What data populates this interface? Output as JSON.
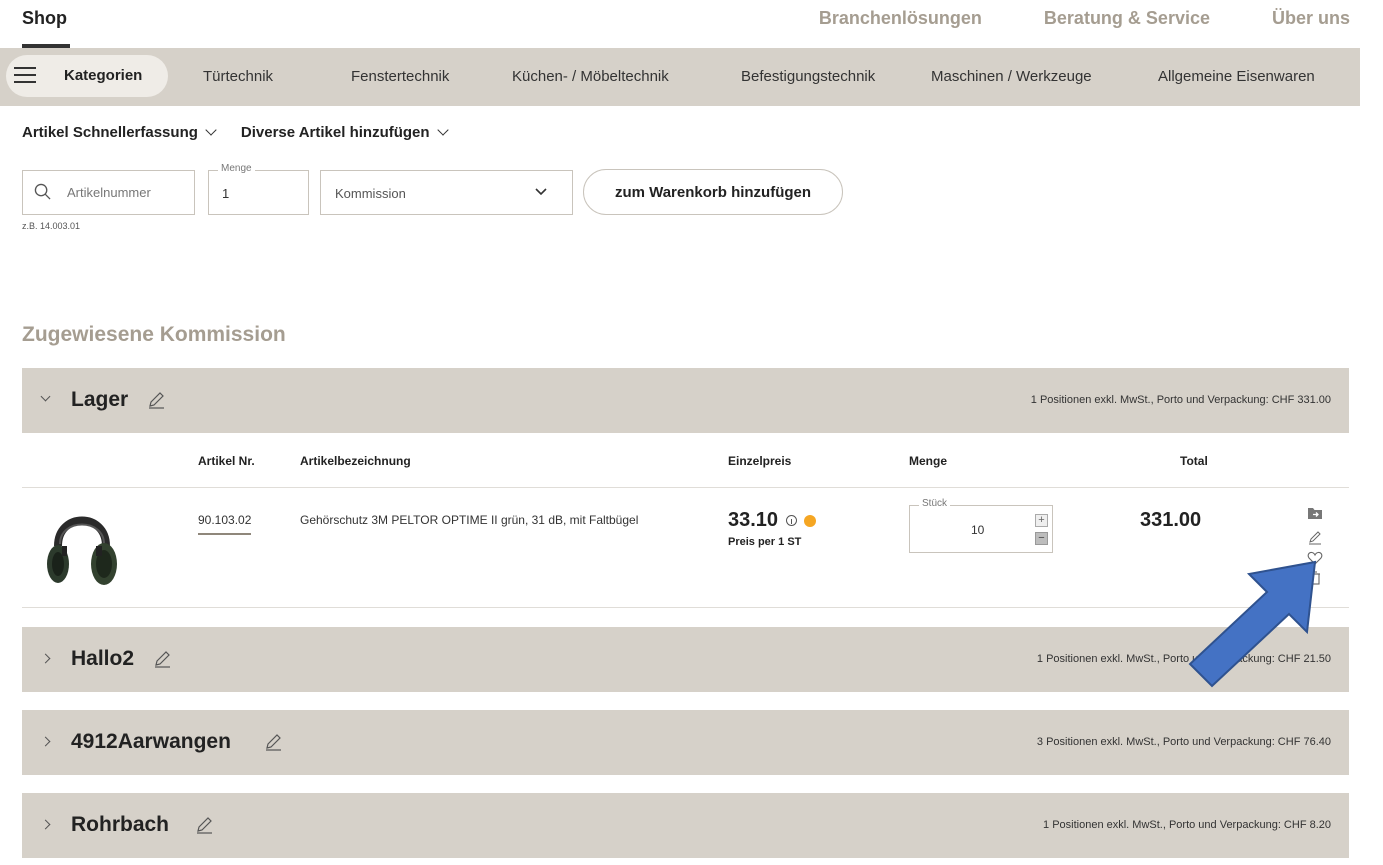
{
  "header": {
    "brand": "Shop",
    "nav": [
      "Branchenlösungen",
      "Beratung & Service",
      "Über uns"
    ]
  },
  "categories": {
    "menu_label": "Kategorien",
    "items": [
      "Türtechnik",
      "Fenstertechnik",
      "Küchen- / Möbeltechnik",
      "Befestigungstechnik",
      "Maschinen / Werkzeuge",
      "Allgemeine Eisenwaren"
    ]
  },
  "quick_entry": {
    "link_schnellerfassung": "Artikel Schnellerfassung",
    "link_diverse": "Diverse Artikel hinzufügen",
    "search_placeholder": "Artikelnummer",
    "search_hint": "z.B. 14.003.01",
    "menge_label": "Menge",
    "menge_value": "1",
    "kommission_label": "Kommission",
    "add_to_cart": "zum Warenkorb hinzufügen"
  },
  "section_title": "Zugewiesene Kommission",
  "groups": [
    {
      "name": "Lager",
      "summary": "1 Positionen exkl. MwSt., Porto und Verpackung: CHF 331.00",
      "expanded": true
    },
    {
      "name": "Hallo2",
      "summary": "1 Positionen exkl. MwSt., Porto und Verpackung: CHF 21.50",
      "expanded": false
    },
    {
      "name": "4912Aarwangen",
      "summary": "3 Positionen exkl. MwSt., Porto und Verpackung: CHF 76.40",
      "expanded": false
    },
    {
      "name": "Rohrbach",
      "summary": "1 Positionen exkl. MwSt., Porto und Verpackung: CHF 8.20",
      "expanded": false
    }
  ],
  "table": {
    "headers": {
      "artikel_nr": "Artikel Nr.",
      "bezeichnung": "Artikelbezeichnung",
      "einzelpreis": "Einzelpreis",
      "menge": "Menge",
      "total": "Total"
    },
    "rows": [
      {
        "artikel_nr": "90.103.02",
        "bezeichnung": "Gehörschutz 3M PELTOR OPTIME II grün, 31 dB, mit Faltbügel",
        "einzelpreis": "33.10",
        "preis_per": "Preis per 1 ST",
        "unit_label": "Stück",
        "menge": "10",
        "total": "331.00"
      }
    ]
  },
  "colors": {
    "accent_muted": "#a59d91",
    "bar_background": "#d6d1c9",
    "stock_indicator": "#f5a623",
    "overlay_arrow": "#4472c4"
  }
}
